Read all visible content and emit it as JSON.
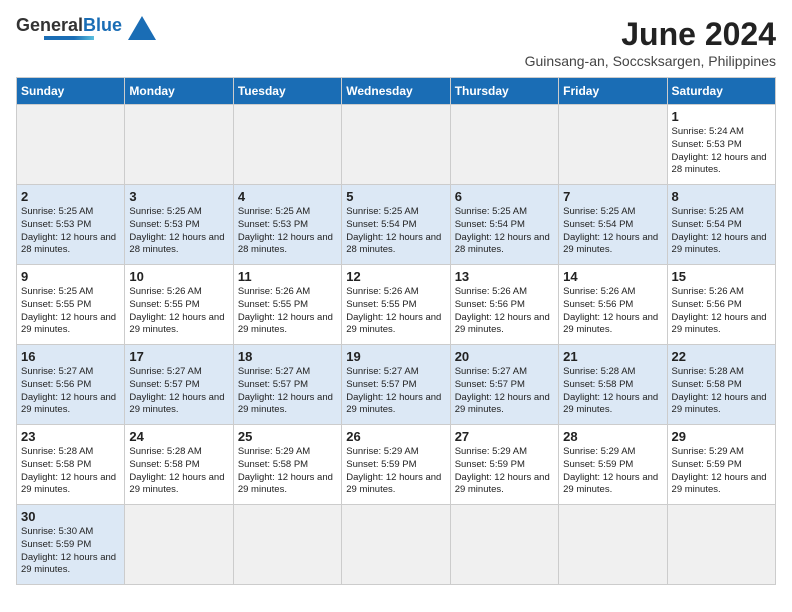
{
  "header": {
    "logo_general": "General",
    "logo_blue": "Blue",
    "month": "June 2024",
    "location": "Guinsang-an, Soccsksargen, Philippines"
  },
  "weekdays": [
    "Sunday",
    "Monday",
    "Tuesday",
    "Wednesday",
    "Thursday",
    "Friday",
    "Saturday"
  ],
  "weeks": [
    {
      "shade": "light",
      "days": [
        {
          "num": "",
          "empty": true
        },
        {
          "num": "",
          "empty": true
        },
        {
          "num": "",
          "empty": true
        },
        {
          "num": "",
          "empty": true
        },
        {
          "num": "",
          "empty": true
        },
        {
          "num": "",
          "empty": true
        },
        {
          "num": "1",
          "sunrise": "5:24 AM",
          "sunset": "5:53 PM",
          "daylight": "12 hours and 28 minutes."
        }
      ]
    },
    {
      "shade": "blue",
      "days": [
        {
          "num": "2",
          "sunrise": "5:25 AM",
          "sunset": "5:53 PM",
          "daylight": "12 hours and 28 minutes."
        },
        {
          "num": "3",
          "sunrise": "5:25 AM",
          "sunset": "5:53 PM",
          "daylight": "12 hours and 28 minutes."
        },
        {
          "num": "4",
          "sunrise": "5:25 AM",
          "sunset": "5:53 PM",
          "daylight": "12 hours and 28 minutes."
        },
        {
          "num": "5",
          "sunrise": "5:25 AM",
          "sunset": "5:54 PM",
          "daylight": "12 hours and 28 minutes."
        },
        {
          "num": "6",
          "sunrise": "5:25 AM",
          "sunset": "5:54 PM",
          "daylight": "12 hours and 28 minutes."
        },
        {
          "num": "7",
          "sunrise": "5:25 AM",
          "sunset": "5:54 PM",
          "daylight": "12 hours and 29 minutes."
        },
        {
          "num": "8",
          "sunrise": "5:25 AM",
          "sunset": "5:54 PM",
          "daylight": "12 hours and 29 minutes."
        }
      ]
    },
    {
      "shade": "light",
      "days": [
        {
          "num": "9",
          "sunrise": "5:25 AM",
          "sunset": "5:55 PM",
          "daylight": "12 hours and 29 minutes."
        },
        {
          "num": "10",
          "sunrise": "5:26 AM",
          "sunset": "5:55 PM",
          "daylight": "12 hours and 29 minutes."
        },
        {
          "num": "11",
          "sunrise": "5:26 AM",
          "sunset": "5:55 PM",
          "daylight": "12 hours and 29 minutes."
        },
        {
          "num": "12",
          "sunrise": "5:26 AM",
          "sunset": "5:55 PM",
          "daylight": "12 hours and 29 minutes."
        },
        {
          "num": "13",
          "sunrise": "5:26 AM",
          "sunset": "5:56 PM",
          "daylight": "12 hours and 29 minutes."
        },
        {
          "num": "14",
          "sunrise": "5:26 AM",
          "sunset": "5:56 PM",
          "daylight": "12 hours and 29 minutes."
        },
        {
          "num": "15",
          "sunrise": "5:26 AM",
          "sunset": "5:56 PM",
          "daylight": "12 hours and 29 minutes."
        }
      ]
    },
    {
      "shade": "blue",
      "days": [
        {
          "num": "16",
          "sunrise": "5:27 AM",
          "sunset": "5:56 PM",
          "daylight": "12 hours and 29 minutes."
        },
        {
          "num": "17",
          "sunrise": "5:27 AM",
          "sunset": "5:57 PM",
          "daylight": "12 hours and 29 minutes."
        },
        {
          "num": "18",
          "sunrise": "5:27 AM",
          "sunset": "5:57 PM",
          "daylight": "12 hours and 29 minutes."
        },
        {
          "num": "19",
          "sunrise": "5:27 AM",
          "sunset": "5:57 PM",
          "daylight": "12 hours and 29 minutes."
        },
        {
          "num": "20",
          "sunrise": "5:27 AM",
          "sunset": "5:57 PM",
          "daylight": "12 hours and 29 minutes."
        },
        {
          "num": "21",
          "sunrise": "5:28 AM",
          "sunset": "5:58 PM",
          "daylight": "12 hours and 29 minutes."
        },
        {
          "num": "22",
          "sunrise": "5:28 AM",
          "sunset": "5:58 PM",
          "daylight": "12 hours and 29 minutes."
        }
      ]
    },
    {
      "shade": "light",
      "days": [
        {
          "num": "23",
          "sunrise": "5:28 AM",
          "sunset": "5:58 PM",
          "daylight": "12 hours and 29 minutes."
        },
        {
          "num": "24",
          "sunrise": "5:28 AM",
          "sunset": "5:58 PM",
          "daylight": "12 hours and 29 minutes."
        },
        {
          "num": "25",
          "sunrise": "5:29 AM",
          "sunset": "5:58 PM",
          "daylight": "12 hours and 29 minutes."
        },
        {
          "num": "26",
          "sunrise": "5:29 AM",
          "sunset": "5:59 PM",
          "daylight": "12 hours and 29 minutes."
        },
        {
          "num": "27",
          "sunrise": "5:29 AM",
          "sunset": "5:59 PM",
          "daylight": "12 hours and 29 minutes."
        },
        {
          "num": "28",
          "sunrise": "5:29 AM",
          "sunset": "5:59 PM",
          "daylight": "12 hours and 29 minutes."
        },
        {
          "num": "29",
          "sunrise": "5:29 AM",
          "sunset": "5:59 PM",
          "daylight": "12 hours and 29 minutes."
        }
      ]
    },
    {
      "shade": "blue",
      "days": [
        {
          "num": "30",
          "sunrise": "5:30 AM",
          "sunset": "5:59 PM",
          "daylight": "12 hours and 29 minutes."
        },
        {
          "num": "",
          "empty": true
        },
        {
          "num": "",
          "empty": true
        },
        {
          "num": "",
          "empty": true
        },
        {
          "num": "",
          "empty": true
        },
        {
          "num": "",
          "empty": true
        },
        {
          "num": "",
          "empty": true
        }
      ]
    }
  ]
}
